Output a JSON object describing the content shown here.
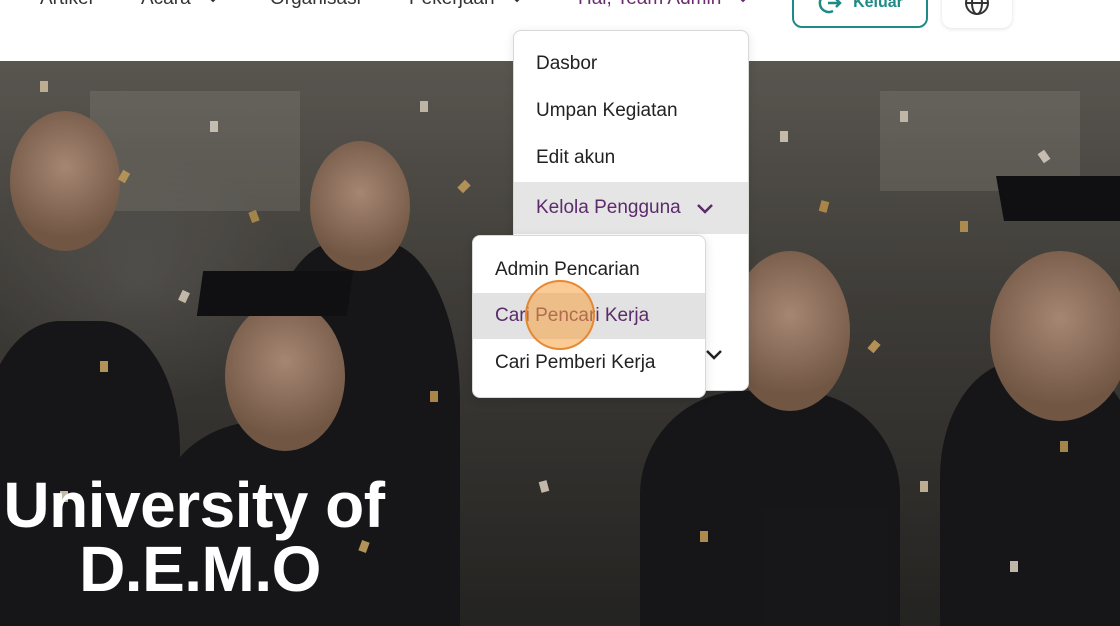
{
  "nav": {
    "items": [
      {
        "label": "Artikel",
        "has_chevron": false
      },
      {
        "label": "Acara",
        "has_chevron": true
      },
      {
        "label": "Organisasi",
        "has_chevron": false
      },
      {
        "label": "Pekerjaan",
        "has_chevron": true
      },
      {
        "label": "Hai, Team Admin",
        "has_chevron": true,
        "active": true
      }
    ],
    "logout_label": "Keluar",
    "accent_color": "#1e8a86",
    "active_color": "#6a2c6e"
  },
  "user_menu": {
    "items": [
      {
        "label": "Dasbor"
      },
      {
        "label": "Umpan Kegiatan"
      },
      {
        "label": "Edit akun"
      },
      {
        "label": "Kelola Pengguna",
        "expanded": true
      }
    ]
  },
  "manage_users_submenu": {
    "items": [
      {
        "label": "Admin Pencarian"
      },
      {
        "label": "Cari Pencari Kerja",
        "hovered": true
      },
      {
        "label": "Cari Pemberi Kerja"
      }
    ]
  },
  "hero": {
    "title_line1": "University of",
    "title_line2": "D.E.M.O"
  }
}
